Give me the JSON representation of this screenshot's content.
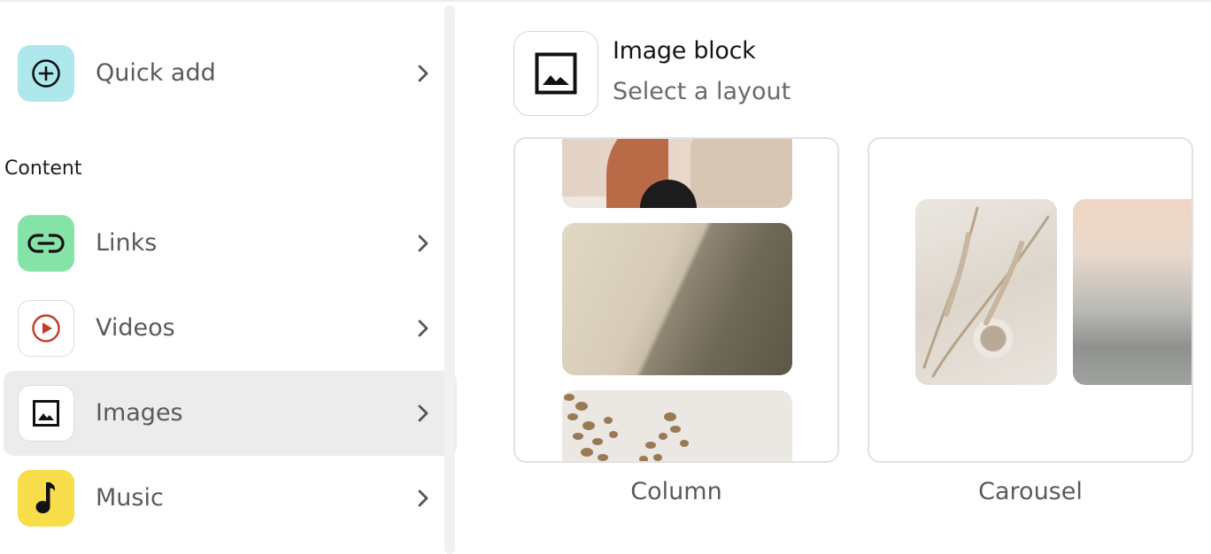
{
  "sidebar": {
    "quick_add": {
      "label": "Quick add",
      "icon": "plus-circle-icon",
      "color": "#aee8ec"
    },
    "section_title": "Content",
    "items": [
      {
        "label": "Links",
        "icon": "link-icon",
        "color": "#86e3a8"
      },
      {
        "label": "Videos",
        "icon": "play-icon",
        "color": "#ffffff",
        "accent": "#c8382c"
      },
      {
        "label": "Images",
        "icon": "image-icon",
        "color": "#ffffff",
        "active": true
      },
      {
        "label": "Music",
        "icon": "music-note-icon",
        "color": "#f8dd4a"
      }
    ]
  },
  "panel": {
    "title": "Image block",
    "subtitle": "Select a layout",
    "layouts": [
      {
        "label": "Column"
      },
      {
        "label": "Carousel"
      }
    ]
  }
}
